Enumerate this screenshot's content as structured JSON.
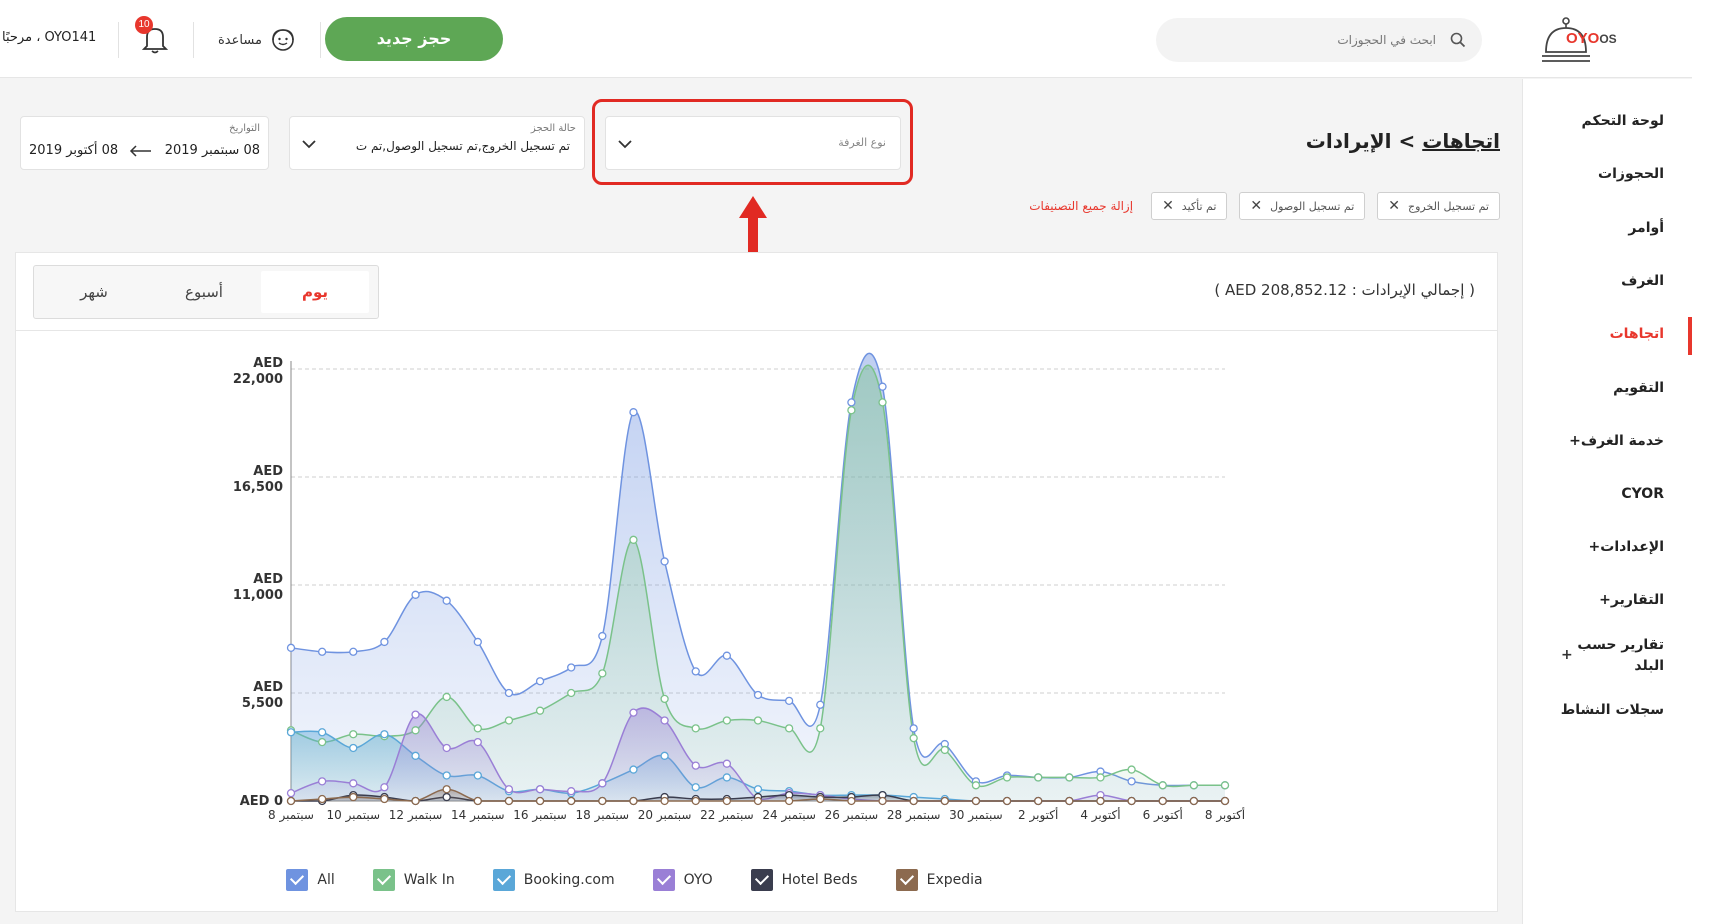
{
  "header": {
    "logo_brand": "OYO",
    "logo_suffix": "OS",
    "search_placeholder": "ابحث في الحجوزات",
    "new_booking_label": "حجز جديد",
    "help_label": "مساعدة",
    "notification_count": "10",
    "greeting": "مرحبًا ، OYO141"
  },
  "sidebar": {
    "items": [
      {
        "label": "لوحة التحكم"
      },
      {
        "label": "الحجوزات"
      },
      {
        "label": "أوامر"
      },
      {
        "label": "الغرف"
      },
      {
        "label": "اتجاهات"
      },
      {
        "label": "التقويم"
      },
      {
        "label": "خدمة الغرف+"
      },
      {
        "label": "CYOR"
      },
      {
        "label": "الإعدادات+"
      },
      {
        "label": "التقارير+"
      },
      {
        "label": "تقارير حسب"
      },
      {
        "label": "البلد"
      },
      {
        "label": "سجلات النشاط"
      }
    ],
    "plus_symbol": "+",
    "active_color": "#e8372d"
  },
  "filters": {
    "date": {
      "label": "التواريخ",
      "from": "08 سبتمبر 2019",
      "to": "08 أكتوبر 2019"
    },
    "booking_status": {
      "label": "حالة الحجز",
      "value": "تم تسجيل الخروج,تم تسجيل الوصول,تم ت"
    },
    "room_type": {
      "placeholder": "نوع الغرفة"
    }
  },
  "breadcrumb": {
    "parent": "اتجاهات",
    "separator": ">",
    "current": "الإيرادات"
  },
  "chips": [
    {
      "label": "تم تسجيل الخروج"
    },
    {
      "label": "تم تسجيل الوصول"
    },
    {
      "label": "تم تأكيد"
    }
  ],
  "clear_all": "إزالة جميع التصنيفات",
  "card": {
    "tabs": [
      {
        "label": "يوم"
      },
      {
        "label": "أسبوع"
      },
      {
        "label": "شهر"
      }
    ],
    "total": "( إجمالي الإيرادات : AED 208,852.12 )"
  },
  "chart_data": {
    "type": "area",
    "x": [
      "8 سبتمبر",
      "9 سبتمبر",
      "10 سبتمبر",
      "11 سبتمبر",
      "12 سبتمبر",
      "13 سبتمبر",
      "14 سبتمبر",
      "15 سبتمبر",
      "16 سبتمبر",
      "17 سبتمبر",
      "18 سبتمبر",
      "19 سبتمبر",
      "20 سبتمبر",
      "21 سبتمبر",
      "22 سبتمبر",
      "23 سبتمبر",
      "24 سبتمبر",
      "25 سبتمبر",
      "26 سبتمبر",
      "27 سبتمبر",
      "28 سبتمبر",
      "29 سبتمبر",
      "30 سبتمبر",
      "1 أكتوبر",
      "2 أكتوبر",
      "3 أكتوبر",
      "4 أكتوبر",
      "5 أكتوبر",
      "6 أكتوبر",
      "7 أكتوبر",
      "8 أكتوبر"
    ],
    "x_tick_labels": [
      "8 سبتمبر",
      "10 سبتمبر",
      "12 سبتمبر",
      "14 سبتمبر",
      "16 سبتمبر",
      "18 سبتمبر",
      "20 سبتمبر",
      "22 سبتمبر",
      "24 سبتمبر",
      "26 سبتمبر",
      "28 سبتمبر",
      "30 سبتمبر",
      "2 أكتوبر",
      "4 أكتوبر",
      "6 أكتوبر",
      "8 أكتوبر"
    ],
    "y_ticks": [
      {
        "value": 0,
        "line1": "AED 0",
        "line2": ""
      },
      {
        "value": 5500,
        "line1": "AED",
        "line2": "5,500"
      },
      {
        "value": 11000,
        "line1": "AED",
        "line2": "11,000"
      },
      {
        "value": 16500,
        "line1": "AED",
        "line2": "16,500"
      },
      {
        "value": 22000,
        "line1": "AED",
        "line2": "22,000"
      }
    ],
    "ylim": [
      0,
      22000
    ],
    "grid": true,
    "legend_position": "bottom",
    "series": [
      {
        "name": "All",
        "color": "#6f93e0",
        "values": [
          7800,
          7600,
          7600,
          8100,
          10500,
          10200,
          8100,
          5500,
          6100,
          6800,
          8400,
          19800,
          12200,
          6600,
          7400,
          5400,
          5100,
          4900,
          20300,
          21100,
          3700,
          2900,
          1000,
          1300,
          1200,
          1200,
          1500,
          1000,
          800,
          800,
          800
        ]
      },
      {
        "name": "Walk In",
        "color": "#7ac28a",
        "values": [
          3600,
          3000,
          3400,
          3300,
          3600,
          5300,
          3700,
          4100,
          4600,
          5500,
          6500,
          13300,
          5200,
          3700,
          4100,
          4100,
          3700,
          3700,
          19900,
          20300,
          3200,
          2600,
          800,
          1200,
          1200,
          1200,
          1200,
          1600,
          800,
          800,
          800
        ]
      },
      {
        "name": "Booking.com",
        "color": "#5aa7d8",
        "values": [
          3500,
          3500,
          2700,
          3400,
          2300,
          1300,
          1300,
          500,
          600,
          400,
          900,
          1600,
          2300,
          700,
          1200,
          600,
          500,
          300,
          300,
          300,
          200,
          100,
          0,
          0,
          0,
          0,
          0,
          0,
          0,
          0,
          0
        ]
      },
      {
        "name": "OYO",
        "color": "#9a7fd6",
        "values": [
          400,
          1000,
          900,
          700,
          4400,
          2700,
          3000,
          600,
          600,
          500,
          900,
          4500,
          4100,
          1800,
          1900,
          100,
          400,
          300,
          100,
          0,
          0,
          0,
          0,
          0,
          0,
          0,
          300,
          0,
          0,
          0,
          0
        ]
      },
      {
        "name": "Hotel Beds",
        "color": "#3a3d4e",
        "values": [
          0,
          0,
          300,
          200,
          0,
          200,
          0,
          0,
          0,
          0,
          0,
          0,
          200,
          100,
          100,
          200,
          300,
          200,
          200,
          300,
          0,
          0,
          0,
          0,
          0,
          0,
          0,
          0,
          0,
          0,
          0
        ]
      },
      {
        "name": "Expedia",
        "color": "#8c6a4f",
        "values": [
          0,
          100,
          200,
          100,
          0,
          600,
          0,
          0,
          0,
          0,
          0,
          0,
          0,
          0,
          0,
          0,
          0,
          100,
          0,
          0,
          0,
          0,
          0,
          0,
          0,
          0,
          0,
          0,
          0,
          0,
          0
        ]
      }
    ]
  }
}
